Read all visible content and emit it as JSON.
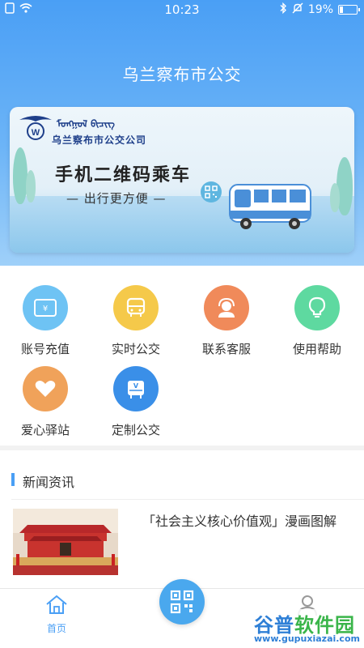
{
  "status_bar": {
    "time": "10:23",
    "battery": "19%"
  },
  "header": {
    "title": "乌兰察布市公交"
  },
  "banner": {
    "mongolian_text": "ᠮᠣᠩᠭᠣᠯ ᠪᠢᠴᠢᠭ",
    "company": "乌兰察布市公交公司",
    "headline": "手机二维码乘车",
    "subline": "— 出行更方便 —"
  },
  "menu": {
    "items": [
      {
        "label": "账号充值",
        "icon": "recharge-card-icon",
        "color": "#6ec3f4"
      },
      {
        "label": "实时公交",
        "icon": "bus-icon",
        "color": "#f5c94a"
      },
      {
        "label": "联系客服",
        "icon": "customer-service-icon",
        "color": "#f08a5a"
      },
      {
        "label": "使用帮助",
        "icon": "lightbulb-icon",
        "color": "#5ed9a0"
      },
      {
        "label": "爱心驿站",
        "icon": "heart-icon",
        "color": "#f0a25a"
      },
      {
        "label": "定制公交",
        "icon": "custom-bus-icon",
        "color": "#3a8fe8"
      }
    ]
  },
  "news": {
    "section_title": "新闻资讯",
    "items": [
      {
        "title": "「社会主义核心价值观」漫画图解"
      }
    ]
  },
  "bottom_nav": {
    "home_label": "首页"
  },
  "watermark": {
    "name_part1": "谷普",
    "name_part2": "软件园",
    "url": "www.gupuxiazai.com"
  },
  "colors": {
    "primary": "#4a9ff5",
    "text": "#333333"
  }
}
